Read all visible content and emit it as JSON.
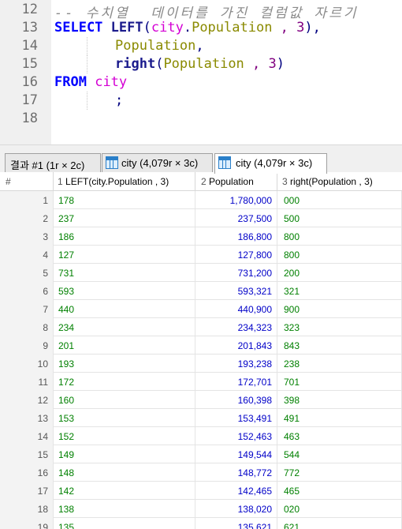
{
  "editor": {
    "lines": [
      {
        "num": "12",
        "comment": "-- 수치열  데이터를 가진 컬럼값 자르기"
      },
      {
        "num": "13"
      },
      {
        "num": "14"
      },
      {
        "num": "15"
      },
      {
        "num": "16"
      },
      {
        "num": "17"
      },
      {
        "num": "18"
      }
    ],
    "tokens": {
      "select": "SELECT",
      "left_fn": "LEFT",
      "open_paren": "(",
      "close_paren": ")",
      "city_table": "city",
      "dot": ".",
      "population": "Population",
      "comma_three": " , 3",
      "trailing_comma": ",",
      "right_fn": "right",
      "from": "FROM",
      "semicolon": ";"
    }
  },
  "tabs": [
    {
      "label": "결과 #1 (1r × 2c)",
      "active": false
    },
    {
      "label": "city (4,079r × 3c)",
      "active": false
    },
    {
      "label": "city (4,079r × 3c)",
      "active": true
    }
  ],
  "grid": {
    "columns": [
      {
        "index": "#",
        "label": ""
      },
      {
        "index": "1",
        "label": "LEFT(city.Population , 3)"
      },
      {
        "index": "2",
        "label": "Population"
      },
      {
        "index": "3",
        "label": "right(Population , 3)"
      }
    ],
    "rows": [
      {
        "n": "1",
        "a": "178",
        "b": "1,780,000",
        "c": "000"
      },
      {
        "n": "2",
        "a": "237",
        "b": "237,500",
        "c": "500"
      },
      {
        "n": "3",
        "a": "186",
        "b": "186,800",
        "c": "800"
      },
      {
        "n": "4",
        "a": "127",
        "b": "127,800",
        "c": "800"
      },
      {
        "n": "5",
        "a": "731",
        "b": "731,200",
        "c": "200"
      },
      {
        "n": "6",
        "a": "593",
        "b": "593,321",
        "c": "321"
      },
      {
        "n": "7",
        "a": "440",
        "b": "440,900",
        "c": "900"
      },
      {
        "n": "8",
        "a": "234",
        "b": "234,323",
        "c": "323"
      },
      {
        "n": "9",
        "a": "201",
        "b": "201,843",
        "c": "843"
      },
      {
        "n": "10",
        "a": "193",
        "b": "193,238",
        "c": "238"
      },
      {
        "n": "11",
        "a": "172",
        "b": "172,701",
        "c": "701"
      },
      {
        "n": "12",
        "a": "160",
        "b": "160,398",
        "c": "398"
      },
      {
        "n": "13",
        "a": "153",
        "b": "153,491",
        "c": "491"
      },
      {
        "n": "14",
        "a": "152",
        "b": "152,463",
        "c": "463"
      },
      {
        "n": "15",
        "a": "149",
        "b": "149,544",
        "c": "544"
      },
      {
        "n": "16",
        "a": "148",
        "b": "148,772",
        "c": "772"
      },
      {
        "n": "17",
        "a": "142",
        "b": "142,465",
        "c": "465"
      },
      {
        "n": "18",
        "a": "138",
        "b": "138,020",
        "c": "020"
      },
      {
        "n": "19",
        "a": "135",
        "b": "135,621",
        "c": "621"
      }
    ]
  }
}
